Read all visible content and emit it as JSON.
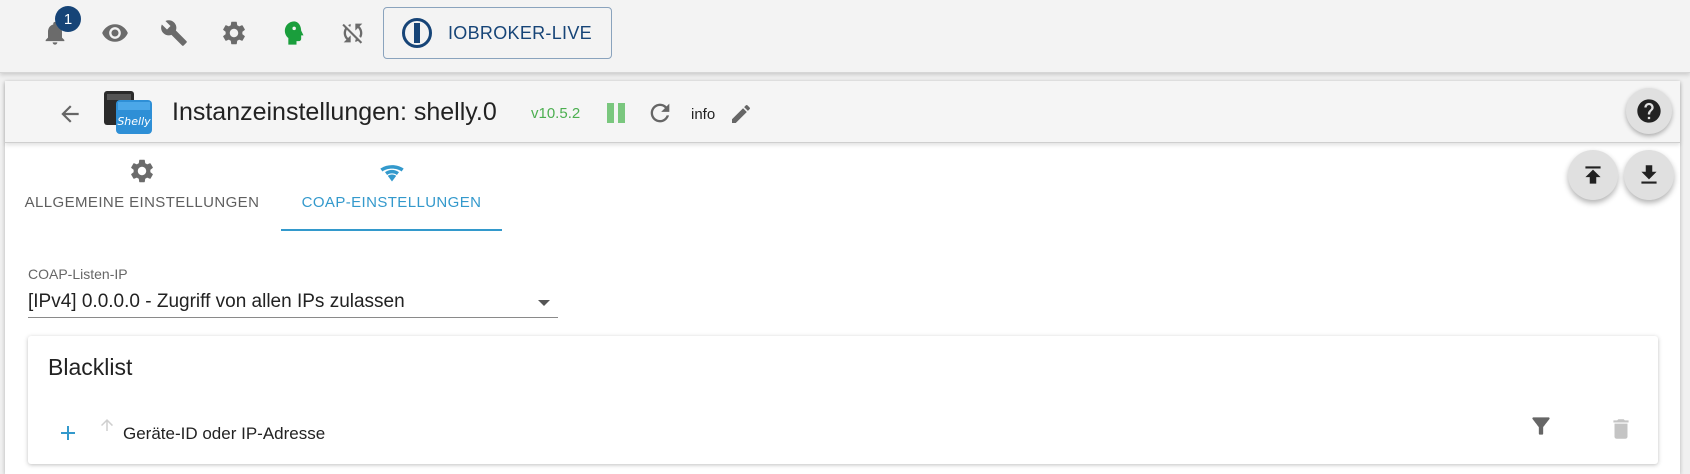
{
  "toolbar": {
    "notifications_count": "1",
    "live_button_label": "IOBROKER-LIVE"
  },
  "header": {
    "title": "Instanzeinstellungen: shelly.0",
    "version": "v10.5.2",
    "log_level": "info"
  },
  "tabs": [
    {
      "label": "ALLGEMEINE EINSTELLUNGEN",
      "icon": "gear-icon",
      "active": false
    },
    {
      "label": "COAP-EINSTELLUNGEN",
      "icon": "wifi-icon",
      "active": true
    }
  ],
  "coap": {
    "listen_ip_label": "COAP-Listen-IP",
    "listen_ip_value": "[IPv4] 0.0.0.0 - Zugriff von allen IPs zulassen"
  },
  "blacklist": {
    "title": "Blacklist",
    "column_header": "Geräte-ID oder IP-Adresse"
  },
  "colors": {
    "accent": "#3399cc",
    "brand": "#164477",
    "version_green": "#4caf50"
  }
}
